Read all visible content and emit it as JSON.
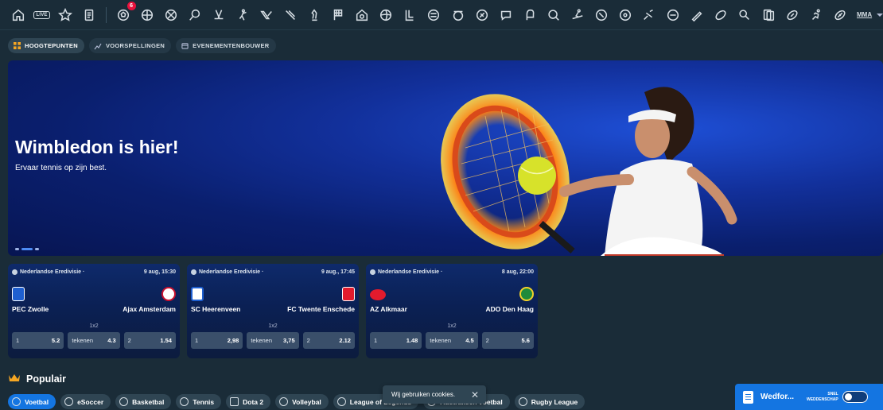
{
  "topbar": {
    "icons": [
      "home-icon",
      "live-icon",
      "star-icon",
      "betslip-icon",
      "soccer-icon",
      "basketball-soccer-icon",
      "basketball-icon",
      "tennis-icon",
      "hockey-icon",
      "baseball-player-icon",
      "valorant-icon",
      "csgo-icon",
      "chess-icon",
      "racing-flag-icon",
      "house-sport-icon",
      "volleyball-icon",
      "league-icon",
      "rocket-league-icon",
      "fifa-icon",
      "cricket-icon",
      "speech-icon",
      "boxing-glove-icon",
      "search-ball-icon",
      "skiing-icon",
      "badminton-icon",
      "snooker-icon",
      "motorsport-icon",
      "slapshot-icon",
      "darts-icon",
      "rugby-icon",
      "table-tennis-icon",
      "cards-icon",
      "american-football-icon",
      "sprint-icon",
      "rugby-ball-icon"
    ],
    "live_label": "LIVE",
    "badge_count": "6",
    "more_label": "MMA"
  },
  "tabs": [
    {
      "label": "HOOGTEPUNTEN",
      "icon": "grid-icon"
    },
    {
      "label": "VOORSPELLINGEN",
      "icon": "chart-icon"
    },
    {
      "label": "EVENEMENTENBOUWER",
      "icon": "calendar-icon"
    }
  ],
  "hero": {
    "title": "Wimbledon is hier!",
    "subtitle": "Ervaar tennis op zijn best."
  },
  "matches": [
    {
      "league": "Nederlandse Eredivisie ·",
      "time": "9 aug, 15:30",
      "home": "PEC Zwolle",
      "away": "Ajax Amsterdam",
      "market": "1x2",
      "odds": [
        {
          "label": "1",
          "value": "5.2"
        },
        {
          "label": "tekenen",
          "value": "4.3"
        },
        {
          "label": "2",
          "value": "1.54"
        }
      ],
      "home_color": "#1e5fd0",
      "away_color": "#ffffff"
    },
    {
      "league": "Nederlandse Eredivisie ·",
      "time": "9 aug., 17:45",
      "home": "SC Heerenveen",
      "away": "FC Twente Enschede",
      "market": "1x2",
      "odds": [
        {
          "label": "1",
          "value": "2,98"
        },
        {
          "label": "tekenen",
          "value": "3,75"
        },
        {
          "label": "2",
          "value": "2.12"
        }
      ],
      "home_color": "#ffffff",
      "away_color": "#e21b2d"
    },
    {
      "league": "Nederlandse Eredivisie ·",
      "time": "8 aug, 22:00",
      "home": "AZ Alkmaar",
      "away": "ADO Den Haag",
      "market": "1x2",
      "odds": [
        {
          "label": "1",
          "value": "1.48"
        },
        {
          "label": "tekenen",
          "value": "4.5"
        },
        {
          "label": "2",
          "value": "5.6"
        }
      ],
      "home_color": "#e21b2d",
      "away_color": "#1f8a3b"
    }
  ],
  "populair": {
    "title": "Populair",
    "chips": [
      "Voetbal",
      "eSoccer",
      "Basketbal",
      "Tennis",
      "Dota 2",
      "Volleybal",
      "League of Legends",
      "Australisch voetbal",
      "Rugby League"
    ]
  },
  "cookie": {
    "text": "Wij gebruiken cookies."
  },
  "betslip": {
    "title": "Wedfor...",
    "flag_line1": "SNEL",
    "flag_line2": "WEDDENSCHAP"
  },
  "colors": {
    "accent": "#1475e1",
    "background": "#1a2c38",
    "badge": "#e9113c"
  }
}
